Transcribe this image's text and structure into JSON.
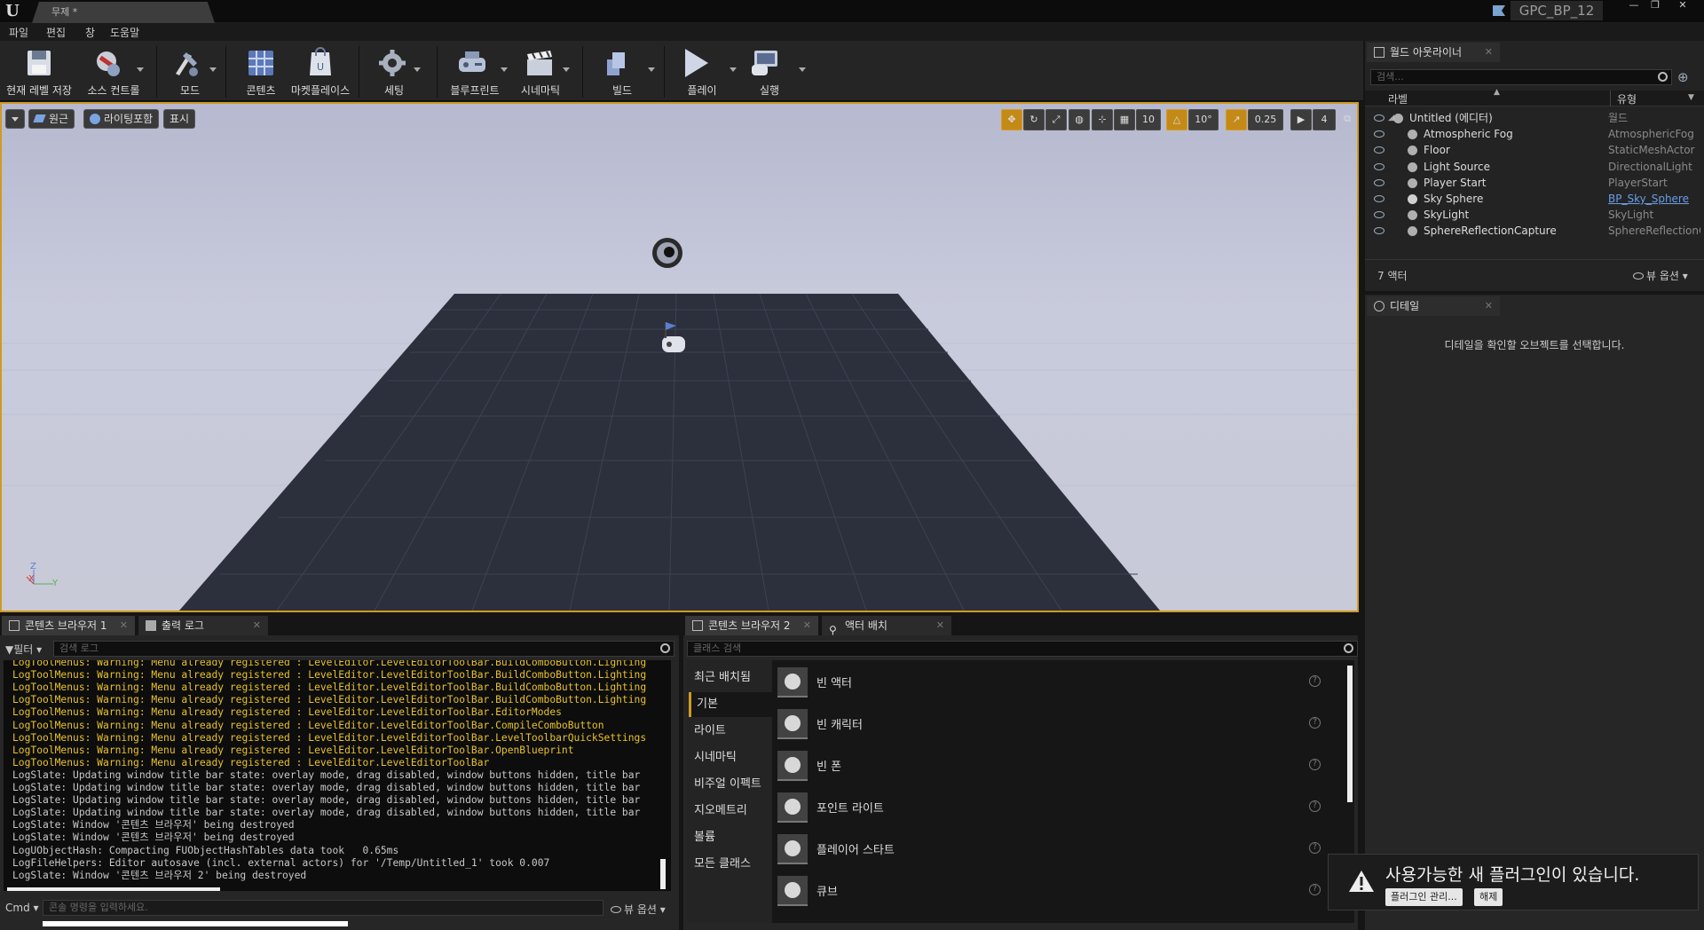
{
  "titlebar": {
    "doc_tab": "무제 *",
    "project": "GPC_BP_12",
    "logo": "U"
  },
  "menu": [
    "파일",
    "편집",
    "창",
    "도움말"
  ],
  "toolbar": {
    "buttons": [
      {
        "label": "현재 레벨 저장",
        "icon": "save-icon"
      },
      {
        "label": "소스 컨트롤",
        "icon": "source-control-icon"
      },
      {
        "label": "모드",
        "icon": "modes-icon"
      },
      {
        "label": "콘텐츠",
        "icon": "content-icon"
      },
      {
        "label": "마켓플레이스",
        "icon": "marketplace-icon"
      },
      {
        "label": "세팅",
        "icon": "settings-icon"
      },
      {
        "label": "블루프린트",
        "icon": "blueprint-icon"
      },
      {
        "label": "시네마틱",
        "icon": "cinematics-icon"
      },
      {
        "label": "빌드",
        "icon": "build-icon"
      },
      {
        "label": "플레이",
        "icon": "play-icon"
      },
      {
        "label": "실행",
        "icon": "launch-icon"
      }
    ]
  },
  "viewport": {
    "perspective": "원근",
    "lit": "라이팅포함",
    "show": "표시",
    "grid_snap": "10",
    "rotation_snap": "10°",
    "scale_snap": "0.25",
    "camera_speed": "4",
    "axis_labels": [
      "Z",
      "X",
      "Y"
    ]
  },
  "outliner": {
    "tab": "월드 아웃라이너",
    "search_placeholder": "검색...",
    "col_label": "라벨",
    "col_type": "유형",
    "rows": [
      {
        "name": "Untitled (에디터)",
        "type": "월드",
        "icon": "world-icon"
      },
      {
        "name": "Atmospheric Fog",
        "type": "AtmosphericFog",
        "icon": "fog-icon"
      },
      {
        "name": "Floor",
        "type": "StaticMeshActor",
        "icon": "static-mesh-icon"
      },
      {
        "name": "Light Source",
        "type": "DirectionalLight",
        "icon": "directional-light-icon"
      },
      {
        "name": "Player Start",
        "type": "PlayerStart",
        "icon": "player-start-icon"
      },
      {
        "name": "Sky Sphere",
        "type": "BP_Sky_Sphere",
        "icon": "sphere-icon"
      },
      {
        "name": "SkyLight",
        "type": "SkyLight",
        "icon": "skylight-icon"
      },
      {
        "name": "SphereReflectionCapture",
        "type": "SphereReflectionC",
        "icon": "reflection-capture-icon"
      }
    ],
    "actor_count": "7 액터",
    "view_options": "뷰 옵션"
  },
  "details": {
    "tab": "디테일",
    "empty_message": "디테일을 확인할 오브젝트를 선택합니다."
  },
  "bottom_left": {
    "tab1": "콘텐츠 브라우저 1",
    "tab2": "출력 로그",
    "filter": "필터",
    "search_placeholder": "검색 로그",
    "log_lines": [
      {
        "text": "LogToolMenus: Warning: Menu already registered : LevelEditor.LevelEditorToolBar.BuildComboButton.Lighting",
        "level": "warning"
      },
      {
        "text": "LogToolMenus: Warning: Menu already registered : LevelEditor.LevelEditorToolBar.BuildComboButton.Lighting",
        "level": "warning"
      },
      {
        "text": "LogToolMenus: Warning: Menu already registered : LevelEditor.LevelEditorToolBar.BuildComboButton.Lighting",
        "level": "warning"
      },
      {
        "text": "LogToolMenus: Warning: Menu already registered : LevelEditor.LevelEditorToolBar.BuildComboButton.Lighting",
        "level": "warning"
      },
      {
        "text": "LogToolMenus: Warning: Menu already registered : LevelEditor.LevelEditorToolBar.EditorModes",
        "level": "warning"
      },
      {
        "text": "LogToolMenus: Warning: Menu already registered : LevelEditor.LevelEditorToolBar.CompileComboButton",
        "level": "warning"
      },
      {
        "text": "LogToolMenus: Warning: Menu already registered : LevelEditor.LevelEditorToolBar.LevelToolbarQuickSettings",
        "level": "warning"
      },
      {
        "text": "LogToolMenus: Warning: Menu already registered : LevelEditor.LevelEditorToolBar.OpenBlueprint",
        "level": "warning"
      },
      {
        "text": "LogToolMenus: Warning: Menu already registered : LevelEditor.LevelEditorToolBar",
        "level": "warning"
      },
      {
        "text": "LogSlate: Updating window title bar state: overlay mode, drag disabled, window buttons hidden, title bar",
        "level": "info"
      },
      {
        "text": "LogSlate: Updating window title bar state: overlay mode, drag disabled, window buttons hidden, title bar",
        "level": "info"
      },
      {
        "text": "LogSlate: Updating window title bar state: overlay mode, drag disabled, window buttons hidden, title bar",
        "level": "info"
      },
      {
        "text": "LogSlate: Updating window title bar state: overlay mode, drag disabled, window buttons hidden, title bar",
        "level": "info"
      },
      {
        "text": "LogSlate: Window '콘텐츠 브라우저' being destroyed",
        "level": "info"
      },
      {
        "text": "LogSlate: Window '콘텐츠 브라우저' being destroyed",
        "level": "info"
      },
      {
        "text": "LogUObjectHash: Compacting FUObjectHashTables data took   0.65ms",
        "level": "info"
      },
      {
        "text": "LogFileHelpers: Editor autosave (incl. external actors) for '/Temp/Untitled_1' took 0.007",
        "level": "info"
      },
      {
        "text": "LogSlate: Window '콘텐츠 브라우저 2' being destroyed",
        "level": "info"
      }
    ],
    "cmd_label": "Cmd",
    "cmd_placeholder": "콘솔 명령을 입력하세요.",
    "view_options": "뷰 옵션"
  },
  "bottom_right": {
    "tab1": "콘텐츠 브라우저 2",
    "tab2": "액터 배치",
    "search_placeholder": "클래스 검색",
    "categories": [
      "최근 배치됨",
      "기본",
      "라이트",
      "시네마틱",
      "비주얼 이펙트",
      "지오메트리",
      "볼륨",
      "모든 클래스"
    ],
    "selected_category": "기본",
    "actors": [
      {
        "label": "빈 액터",
        "icon": "empty-actor-icon"
      },
      {
        "label": "빈 캐릭터",
        "icon": "empty-character-icon"
      },
      {
        "label": "빈 폰",
        "icon": "empty-pawn-icon"
      },
      {
        "label": "포인트 라이트",
        "icon": "point-light-icon"
      },
      {
        "label": "플레이어 스타트",
        "icon": "player-start-icon"
      },
      {
        "label": "큐브",
        "icon": "cube-icon"
      }
    ]
  },
  "notification": {
    "message": "사용가능한 새 플러그인이 있습니다.",
    "manage_button": "플러그인 관리...",
    "dismiss_button": "해제"
  },
  "colors": {
    "accent": "#d09a22",
    "warning_text": "#e8c22c",
    "info_text": "#c8c8c8",
    "link": "#6a9ee8"
  }
}
